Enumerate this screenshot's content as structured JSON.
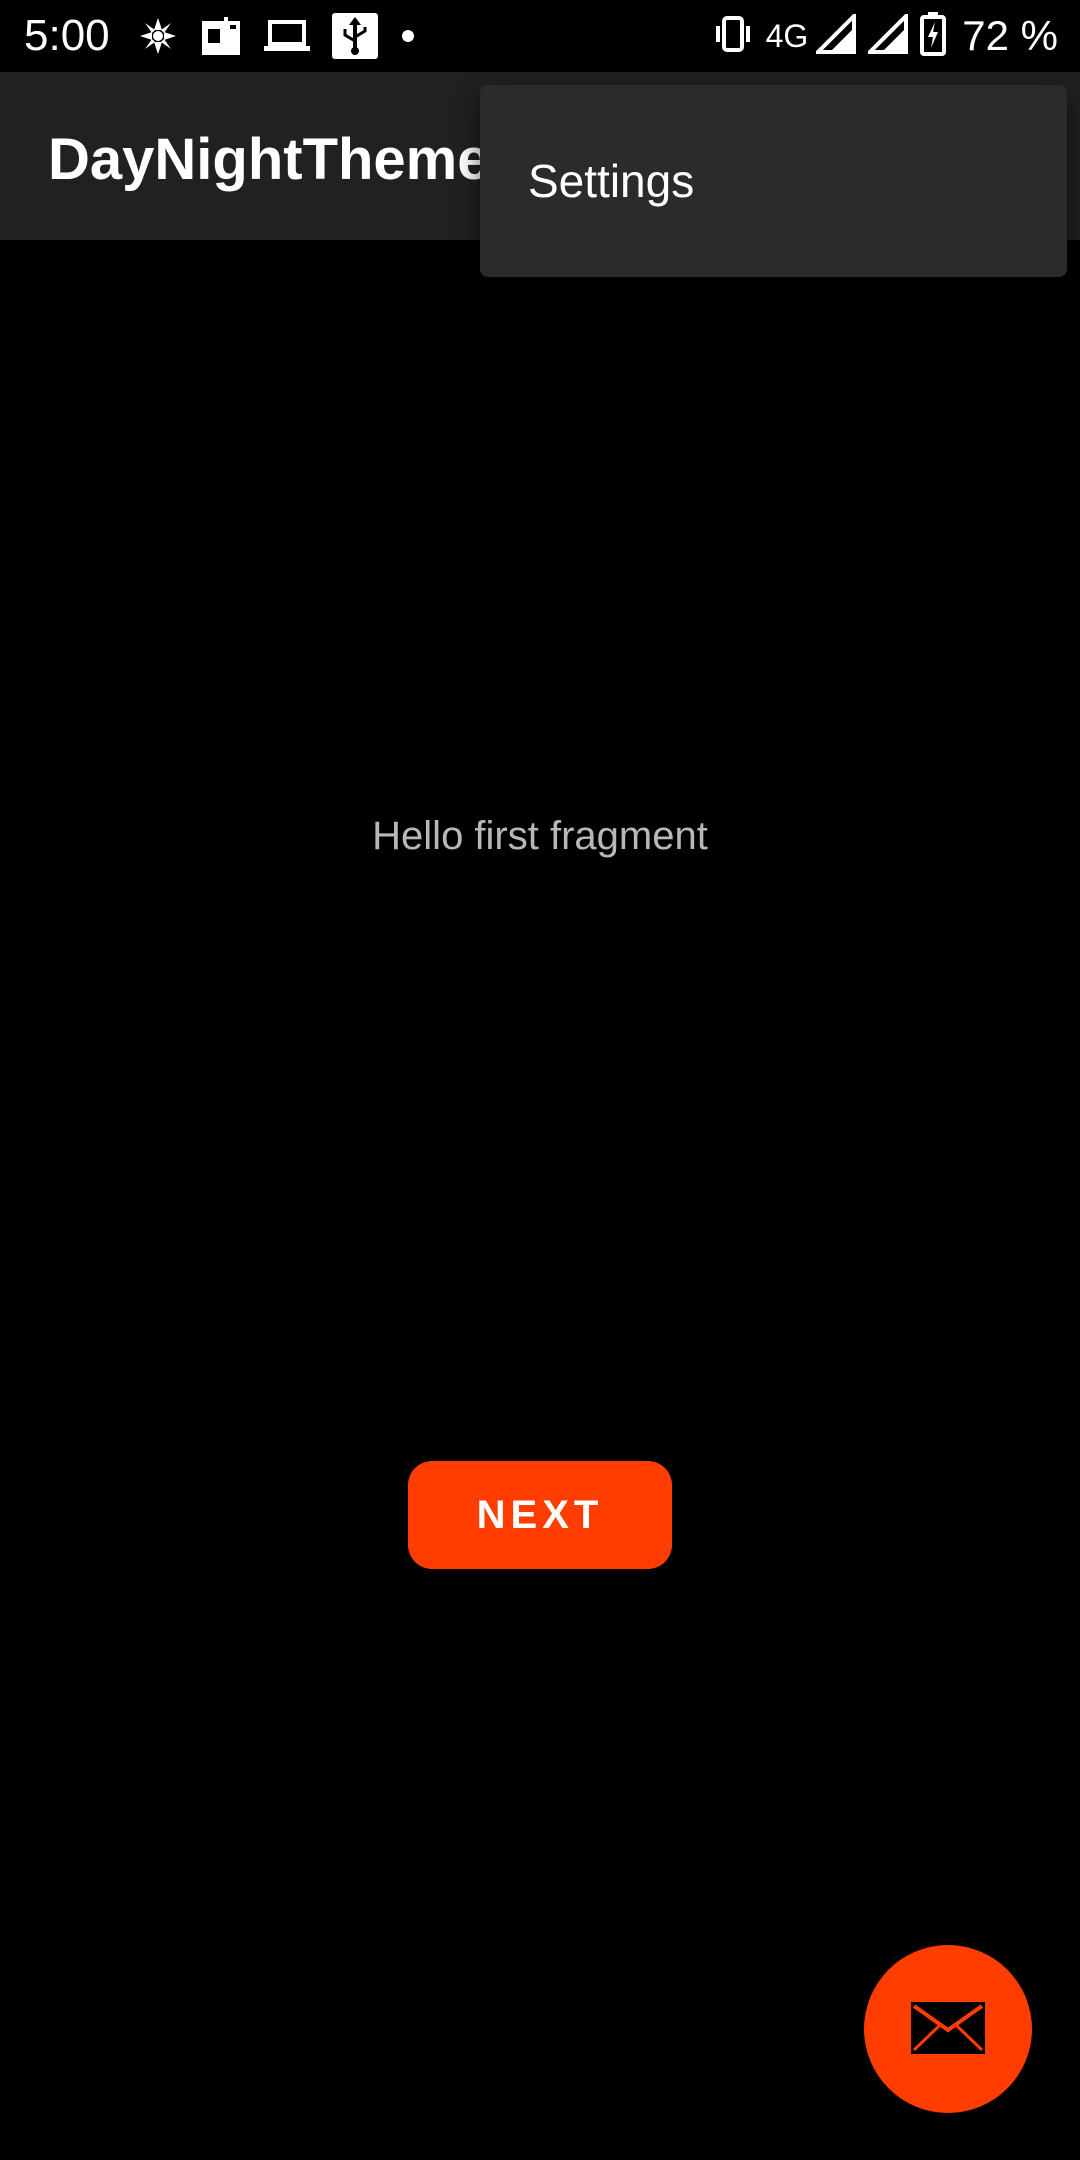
{
  "status_bar": {
    "time": "5:00",
    "network": "4G",
    "battery": "72 %",
    "left_icons": [
      "pinwheel-icon",
      "shopping-bag-icon",
      "laptop-icon",
      "usb-icon",
      "notification-dot-icon"
    ],
    "right_icons": [
      "vibrate-icon",
      "signal-icon",
      "signal-icon",
      "battery-charging-icon"
    ]
  },
  "app_bar": {
    "title": "DayNightTheme"
  },
  "overflow_menu": {
    "items": [
      {
        "label": "Settings"
      }
    ]
  },
  "content": {
    "message": "Hello first fragment",
    "next_button_label": "NEXT"
  },
  "fab": {
    "icon": "email-icon"
  },
  "colors": {
    "accent": "#ff3d00",
    "app_bar": "#212121",
    "menu": "#2b2b2b",
    "background": "#000000"
  }
}
